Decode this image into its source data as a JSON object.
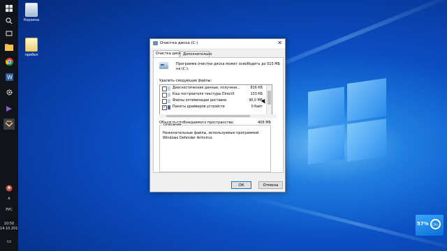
{
  "taskbar": {
    "icons": [
      "windows-icon",
      "search-icon",
      "task-view-icon",
      "file-explorer-icon",
      "chrome-icon",
      "word-icon",
      "settings-icon",
      "media-icon",
      "app-icon"
    ],
    "tray": {
      "language": "РУС",
      "time": "10:50",
      "date": "14.10.2019"
    }
  },
  "desktop": {
    "icons": [
      {
        "label": "Корзина",
        "icon": "recycle-bin-icon"
      },
      {
        "label": "пробел",
        "icon": "file-icon"
      }
    ]
  },
  "dialog": {
    "title": "Очистка диска (C:)",
    "close": "✕",
    "tabs": [
      {
        "label": "Очистка диска",
        "active": true
      },
      {
        "label": "Дополнительно",
        "active": false
      }
    ],
    "intro": "Программа очистки диска может освободить до 510 МБ на (C:).",
    "files_label": "Удалить следующие файлы:",
    "files": [
      {
        "name": "Диагностические данные, получени...",
        "size": "816 КБ",
        "checked": false
      },
      {
        "name": "Кэш построителя текстуры DirectX",
        "size": "133 КБ",
        "checked": false
      },
      {
        "name": "Файлы оптимизации доставки",
        "size": "90,0 МБ",
        "checked": false
      },
      {
        "name": "Пакеты драйверов устройств",
        "size": "0 байт",
        "checked": true
      }
    ],
    "freed_label": "Объем высвобождаемого пространства:",
    "freed_value": "406 МБ",
    "desc_label": "Описание",
    "desc_text": "Нежелательные файлы, используемые программой Windows Defender Antivirus",
    "ok": "ОК",
    "cancel": "Отмена"
  },
  "widget": {
    "percent": "57%",
    "label": "CPU"
  }
}
